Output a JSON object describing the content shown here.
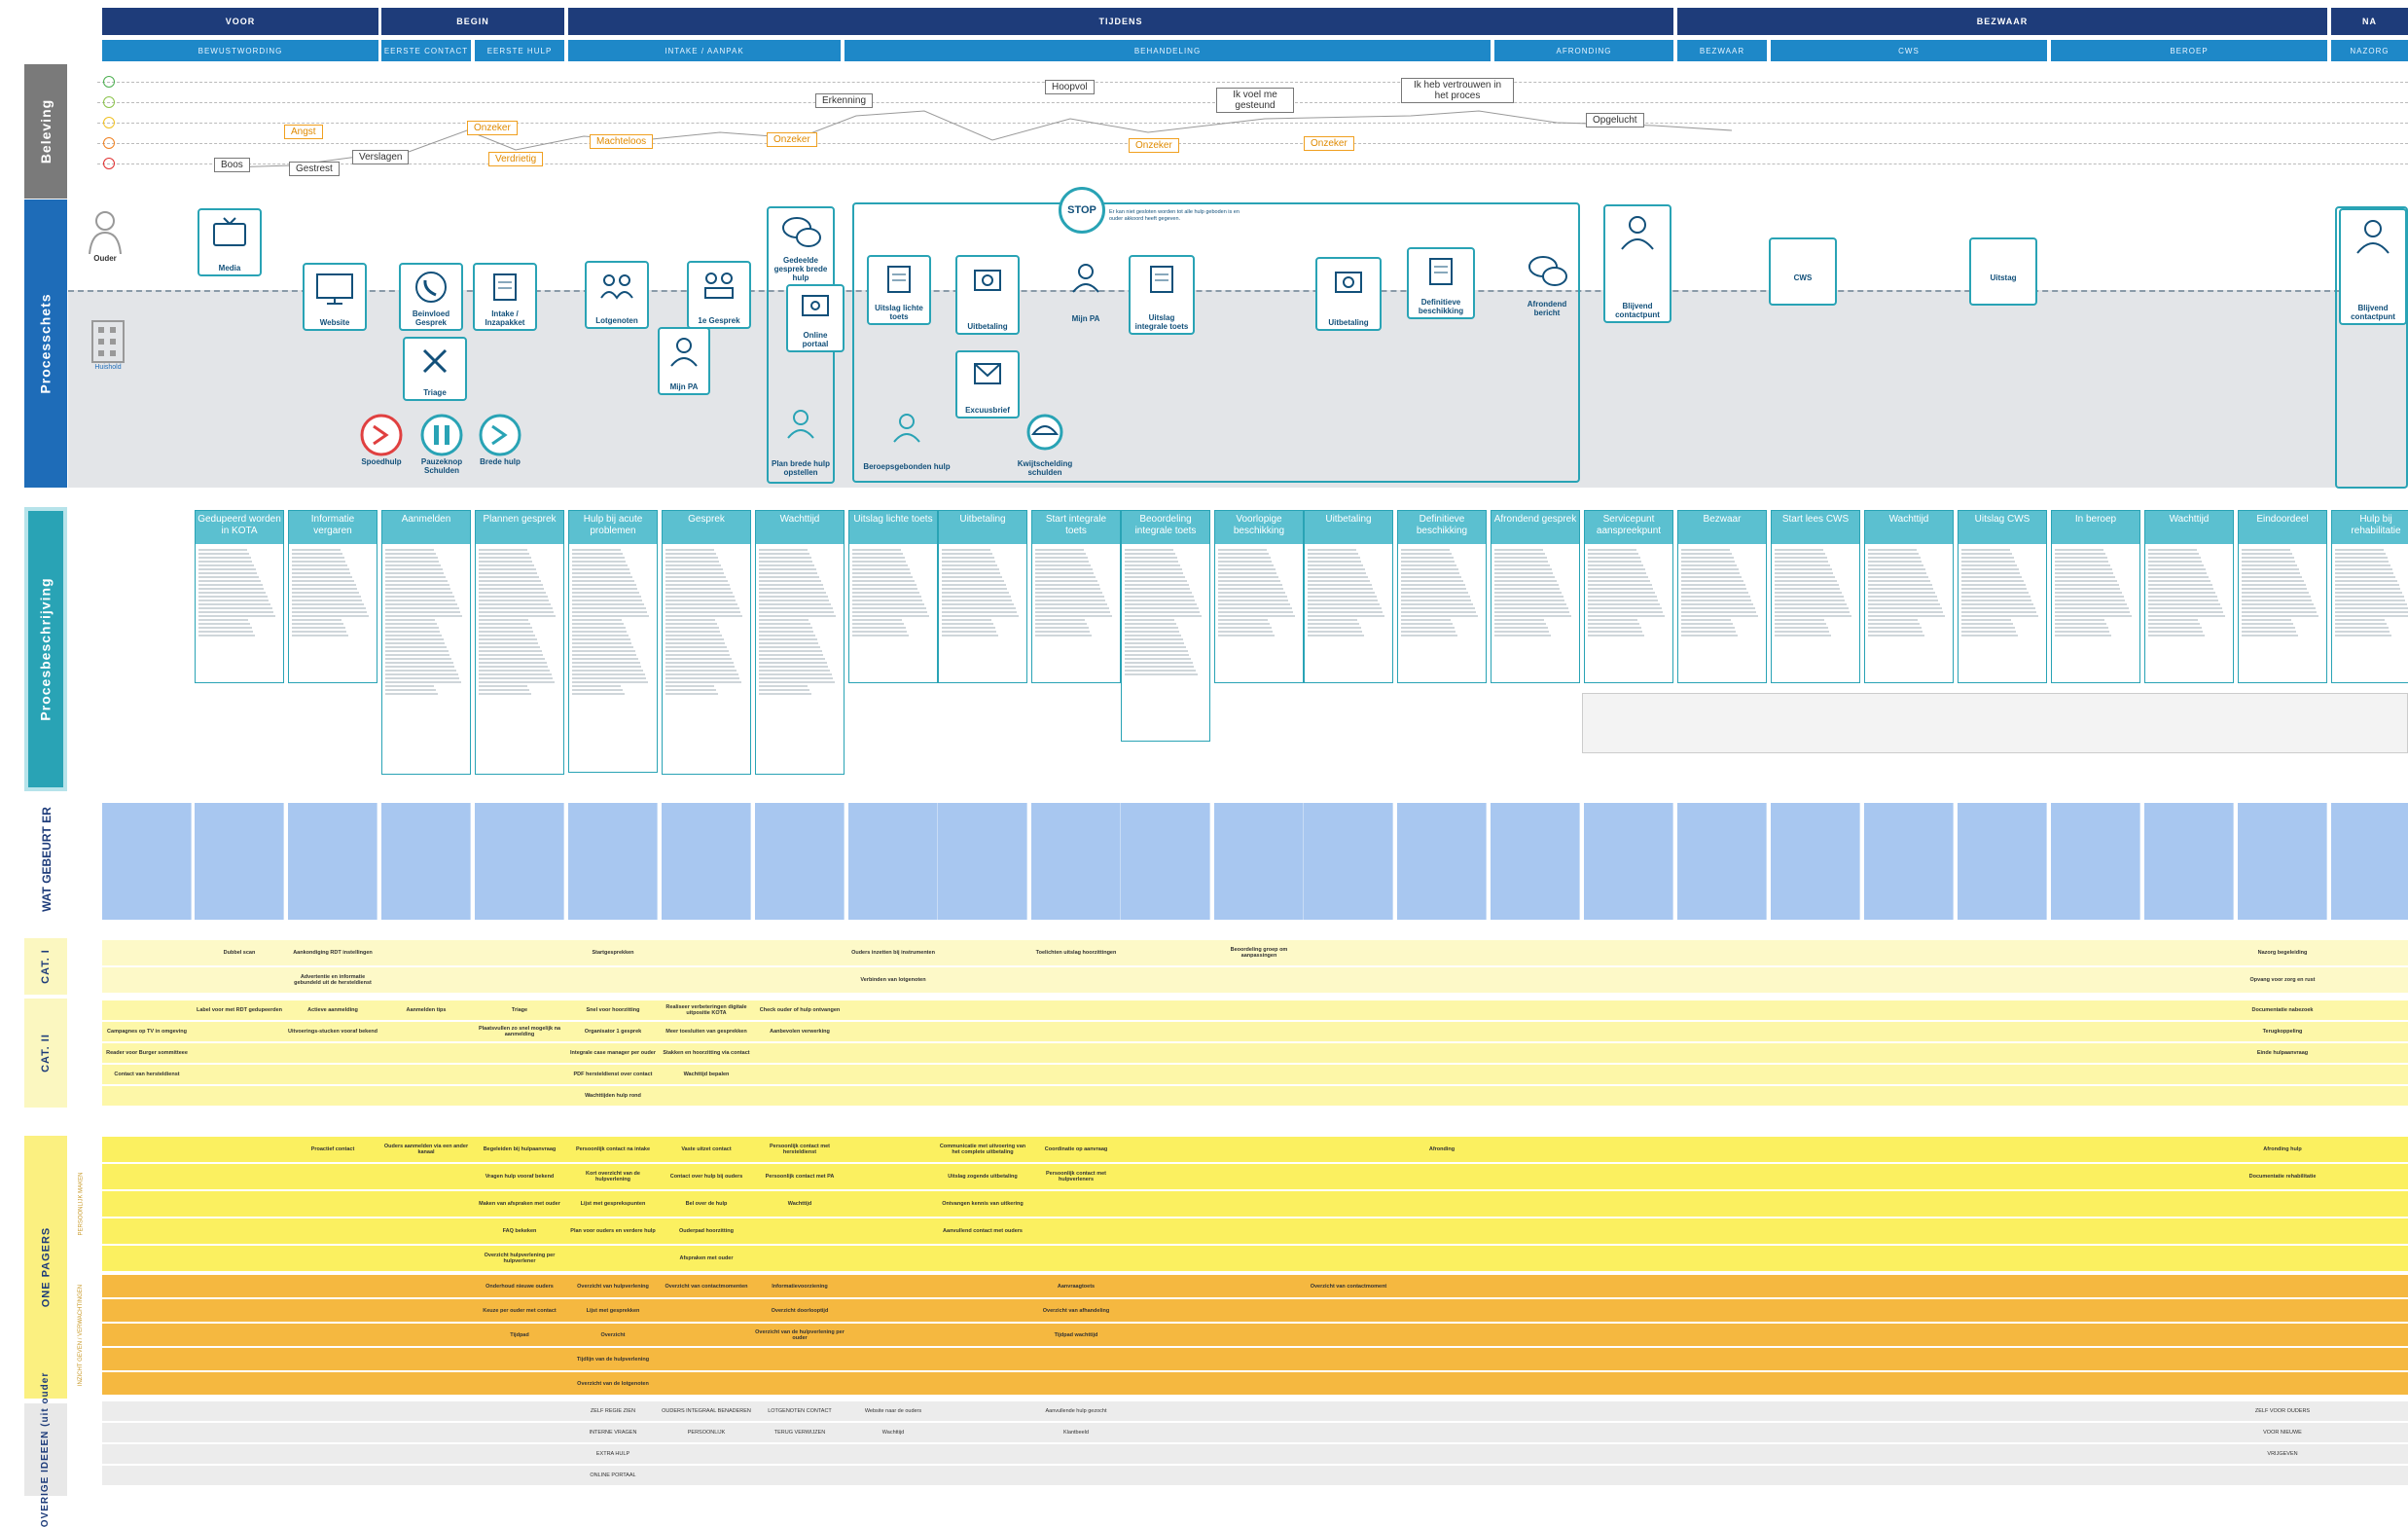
{
  "phases": [
    {
      "label": "VOOR"
    },
    {
      "label": "BEGIN"
    },
    {
      "label": "TIJDENS"
    },
    {
      "label": "BEZWAAR"
    },
    {
      "label": "NA"
    }
  ],
  "subphases": [
    {
      "label": "BEWUSTWORDING"
    },
    {
      "label": "EERSTE CONTACT"
    },
    {
      "label": "EERSTE HULP"
    },
    {
      "label": "INTAKE / AANPAK"
    },
    {
      "label": "BEHANDELING"
    },
    {
      "label": "AFRONDING"
    },
    {
      "label": "BEZWAAR"
    },
    {
      "label": "CWS"
    },
    {
      "label": "BEROEP"
    },
    {
      "label": "NAZORG"
    }
  ],
  "side_labels": {
    "beleving": "Beleving",
    "processchets": "Processchets",
    "procesbeschrijving": "Procesbeschrijving",
    "wat_gebeurt_er": "WAT GEBEURT ER",
    "cat1": "CAT. I",
    "cat2": "CAT. II",
    "one_pagers": "ONE PAGERS",
    "overige": "OVERIGE IDEEEN (uit ouder",
    "sub_persoonlijk": "PERSOONLIJK MAKEN",
    "sub_inzicht": "INZICHT GEVEN / VERWACHTINGEN"
  },
  "emotion_colors": [
    "#4caf50",
    "#8bc34a",
    "#f0c020",
    "#f08020",
    "#e03030"
  ],
  "emotions": [
    {
      "label": "Boos",
      "style": "grey"
    },
    {
      "label": "Gestrest",
      "style": "grey"
    },
    {
      "label": "Verslagen",
      "style": "grey"
    },
    {
      "label": "Angst",
      "style": "orange"
    },
    {
      "label": "Onzeker",
      "style": "orange"
    },
    {
      "label": "Verdrietig",
      "style": "orange"
    },
    {
      "label": "Machteloos",
      "style": "orange"
    },
    {
      "label": "Onzeker",
      "style": "orange"
    },
    {
      "label": "Erkenning",
      "style": "grey"
    },
    {
      "label": "Hoopvol",
      "style": "grey"
    },
    {
      "label": "Ik voel me gesteund",
      "style": "grey"
    },
    {
      "label": "Onzeker",
      "style": "orange"
    },
    {
      "label": "Onzeker",
      "style": "orange"
    },
    {
      "label": "Ik heb vertrouwen in het proces",
      "style": "grey"
    },
    {
      "label": "Opgelucht",
      "style": "grey"
    }
  ],
  "process_icons": [
    {
      "label": "Ouder",
      "icon": "person-icon"
    },
    {
      "label": "Media",
      "icon": "tv-icon"
    },
    {
      "label": "Huishold",
      "icon": "building-icon"
    },
    {
      "label": "Website",
      "icon": "monitor-icon"
    },
    {
      "label": "Beinvloed Gesprek",
      "icon": "phone-icon"
    },
    {
      "label": "Intake / Inzapakket",
      "icon": "document-icon"
    },
    {
      "label": "Triage",
      "icon": "triage-icon"
    },
    {
      "label": "Lotgenoten",
      "icon": "group-icon"
    },
    {
      "label": "1e Gesprek",
      "icon": "meeting-icon"
    },
    {
      "label": "Mijn PA",
      "icon": "person-icon"
    },
    {
      "label": "Gedeelde gesprek brede hulp",
      "icon": "chat-icon"
    },
    {
      "label": "Online portaal",
      "icon": "portal-icon"
    },
    {
      "label": "Plan brede hulp opstellen",
      "icon": "person-icon"
    },
    {
      "label": "Uitslag lichte toets",
      "icon": "document-icon"
    },
    {
      "label": "Uitbetaling",
      "icon": "money-icon"
    },
    {
      "label": "Mijn PA",
      "icon": "person-icon"
    },
    {
      "label": "Uitslag integrale toets",
      "icon": "document-icon"
    },
    {
      "label": "Excuusbrief",
      "icon": "mail-icon"
    },
    {
      "label": "Uitbetaling",
      "icon": "money-icon"
    },
    {
      "label": "Definitieve beschikking",
      "icon": "document-icon"
    },
    {
      "label": "Afrondend bericht",
      "icon": "chat-icon"
    },
    {
      "label": "Blijvend contactpunt",
      "icon": "person-icon"
    },
    {
      "label": "CWS",
      "icon": "blank-icon"
    },
    {
      "label": "Uitstag",
      "icon": "blank-icon"
    },
    {
      "label": "Blijvend contactpunt",
      "icon": "person-icon"
    },
    {
      "label": "Beroepsgebonden hulp",
      "icon": "person-icon"
    },
    {
      "label": "Kwijtschelding schulden",
      "icon": "umbrella-icon"
    },
    {
      "label": "Spoedhulp",
      "icon": "arrow-icon"
    },
    {
      "label": "Pauzeknop Schulden",
      "icon": "pause-icon"
    },
    {
      "label": "Brede hulp",
      "icon": "arrow-icon"
    }
  ],
  "stop_text": "Er kan niet gesloten worden tot alle hulp geboden is en ouder akkoord heeft gegeven.",
  "desc_columns": [
    {
      "title": "Gedupeerd worden in KOTA"
    },
    {
      "title": "Informatie vergaren"
    },
    {
      "title": "Aanmelden"
    },
    {
      "title": "Plannen gesprek"
    },
    {
      "title": "Hulp bij acute problemen"
    },
    {
      "title": "Gesprek"
    },
    {
      "title": "Wachttijd"
    },
    {
      "title": "Uitslag lichte toets"
    },
    {
      "title": "Uitbetaling"
    },
    {
      "title": "Start integrale toets"
    },
    {
      "title": "Beoordeling integrale toets"
    },
    {
      "title": "Voorlopige beschikking"
    },
    {
      "title": "Uitbetaling"
    },
    {
      "title": "Definitieve beschikking"
    },
    {
      "title": "Afrondend gesprek"
    },
    {
      "title": "Servicepunt aanspreekpunt"
    },
    {
      "title": "Bezwaar"
    },
    {
      "title": "Start lees CWS"
    },
    {
      "title": "Wachttijd"
    },
    {
      "title": "Uitslag CWS"
    },
    {
      "title": "In beroep"
    },
    {
      "title": "Wachttijd"
    },
    {
      "title": "Eindoordeel"
    },
    {
      "title": "Hulp bij rehabilitatie"
    }
  ],
  "cat1_rows": [
    [
      "",
      "Dubbel scan",
      "Aankondiging RDT instellingen",
      "",
      "",
      "Startgesprekken",
      "",
      "",
      "Ouders inzetten bij instrumenten",
      "",
      "Toelichten uitslag hoorzittingen",
      "",
      "Beoordeling groep om aanpassingen",
      "",
      "",
      "",
      "",
      "",
      "",
      "",
      "",
      "",
      "",
      "Nazorg begeleiding"
    ],
    [
      "",
      "",
      "Advertentie en informatie gebundeld uit de hersteldienst",
      "",
      "",
      "",
      "",
      "",
      "Verbinden van lotgenoten",
      "",
      "",
      "",
      "",
      "",
      "",
      "",
      "",
      "",
      "",
      "",
      "",
      "",
      "",
      "Opvang voor zorg en rust"
    ]
  ],
  "cat2_rows": [
    [
      "",
      "Label voor met RDT gedupeerden",
      "Actieve aanmelding",
      "Aanmelden tips",
      "Triage",
      "Snel voor hoorzitting",
      "Realiseer verbeteringen digitale uitpositie KOTA",
      "Check ouder of hulp ontvangen",
      "",
      "",
      "",
      "",
      "",
      "",
      "",
      "",
      "",
      "",
      "",
      "",
      "",
      "",
      "",
      "Documentatie nabezoek"
    ],
    [
      "Campagnes op TV in omgeving",
      "",
      "Uitvoerings-stucken vooraf bekend",
      "",
      "Plaatsvullen zo snel mogelijk na aanmelding",
      "Organisator 1 gesprek",
      "Meer toesluiten van gesprekken",
      "Aanbevolen verwerking",
      "",
      "",
      "",
      "",
      "",
      "",
      "",
      "",
      "",
      "",
      "",
      "",
      "",
      "",
      "",
      "Terugkoppeling"
    ],
    [
      "Reader voor Burger sommitteee",
      "",
      "",
      "",
      "",
      "Integrale case manager per ouder",
      "Stakken en hoorzitting via contact",
      "",
      "",
      "",
      "",
      "",
      "",
      "",
      "",
      "",
      "",
      "",
      "",
      "",
      "",
      "",
      "",
      "Einde hulpaanvraag"
    ],
    [
      "Contact van hersteldienst",
      "",
      "",
      "",
      "",
      "PDF hersteldienst over contact",
      "Wachttijd bepalen",
      "",
      "",
      "",
      "",
      "",
      "",
      "",
      "",
      "",
      "",
      "",
      "",
      "",
      "",
      "",
      "",
      ""
    ],
    [
      "",
      "",
      "",
      "",
      "",
      "Wachttijden hulp rond",
      "",
      "",
      "",
      "",
      "",
      "",
      "",
      "",
      "",
      "",
      "",
      "",
      "",
      "",
      "",
      "",
      "",
      ""
    ]
  ],
  "one_pager_rows": [
    [
      "",
      "",
      "Proactief contact",
      "Ouders aanmelden via een ander kanaal",
      "Begeleiden bij hulpaanvraag",
      "Persoonlijk contact na intake",
      "Vaste uitzet contact",
      "Persoonlijk contact met hersteldienst",
      "",
      "Communicatie met uitvoering van het complete uitbetaling",
      "Coordinatie op aanvraag",
      "",
      "",
      "",
      "Afronding",
      "",
      "",
      "",
      "",
      "",
      "",
      "",
      "",
      "Afronding hulp"
    ],
    [
      "",
      "",
      "",
      "",
      "Vragen hulp vooraf bekend",
      "Kort overzicht van de hulpverlening",
      "Contact over hulp bij ouders",
      "Persoonlijk contact met PA",
      "",
      "Uitslag zogende uitbetaling",
      "Persoonlijk contact met hulpverleners",
      "",
      "",
      "",
      "",
      "",
      "",
      "",
      "",
      "",
      "",
      "",
      "",
      "Documentatie rehabilitatie"
    ],
    [
      "",
      "",
      "",
      "",
      "Maken van afspraken met ouder",
      "Lijst met gesprekspunten",
      "Bel over de hulp",
      "Wachttijd",
      "",
      "Ontvangen kennis van uitkering",
      "",
      "",
      "",
      "",
      "",
      "",
      "",
      "",
      "",
      "",
      "",
      "",
      "",
      ""
    ],
    [
      "",
      "",
      "",
      "",
      "FAQ bekeken",
      "Plan voor ouders en verdere hulp",
      "Ouderpad hoorzitting",
      "",
      "",
      "Aanvullend contact met ouders",
      "",
      "",
      "",
      "",
      "",
      "",
      "",
      "",
      "",
      "",
      "",
      "",
      "",
      ""
    ],
    [
      "",
      "",
      "",
      "",
      "Overzicht hulpverlening per hulpverlener",
      "",
      "Afspraken met ouder",
      "",
      "",
      "",
      "",
      "",
      "",
      "",
      "",
      "",
      "",
      "",
      "",
      "",
      "",
      "",
      "",
      ""
    ],
    [
      "",
      "",
      "",
      "",
      "Onderhoud nieuwe ouders",
      "Overzicht van hulpverlening",
      "Overzicht van contactmomenten",
      "Informatievoorziening",
      "",
      "",
      "Aanvraagtoets",
      "",
      "",
      "Overzicht van contactmoment",
      "",
      "",
      "",
      "",
      "",
      "",
      "",
      "",
      "",
      ""
    ],
    [
      "",
      "",
      "",
      "",
      "Keuze per ouder met contact",
      "Lijst met gesprekken",
      "",
      "Overzicht doorlooptijd",
      "",
      "",
      "Overzicht van afhandeling",
      "",
      "",
      "",
      "",
      "",
      "",
      "",
      "",
      "",
      "",
      "",
      "",
      ""
    ],
    [
      "",
      "",
      "",
      "",
      "Tijdpad",
      "Overzicht",
      "",
      "Overzicht van de hulpverlening per ouder",
      "",
      "",
      "Tijdpad wachttijd",
      "",
      "",
      "",
      "",
      "",
      "",
      "",
      "",
      "",
      "",
      "",
      "",
      ""
    ],
    [
      "",
      "",
      "",
      "",
      "",
      "Tijdlijn van de hulpverlening",
      "",
      "",
      "",
      "",
      "",
      "",
      "",
      "",
      "",
      "",
      "",
      "",
      "",
      "",
      "",
      "",
      "",
      ""
    ],
    [
      "",
      "",
      "",
      "",
      "",
      "Overzicht van de lotgenoten",
      "",
      "",
      "",
      "",
      "",
      "",
      "",
      "",
      "",
      "",
      "",
      "",
      "",
      "",
      "",
      "",
      "",
      ""
    ]
  ],
  "overige_rows": [
    [
      "",
      "",
      "",
      "",
      "",
      "ZELF REGIE ZIEN",
      "OUDERS INTEGRAAL BENADEREN",
      "LOTGENOTEN CONTACT",
      "Website naar de ouders",
      "",
      "Aanvullende hulp gezocht",
      "",
      "",
      "",
      "",
      "",
      "",
      "",
      "",
      "",
      "",
      "",
      "",
      "ZELF VOOR OUDERS"
    ],
    [
      "",
      "",
      "",
      "",
      "",
      "INTERNE VRAGEN",
      "PERSOONLIJK",
      "TERUG VERWIJZEN",
      "Wachttijd",
      "",
      "Klantbeeld",
      "",
      "",
      "",
      "",
      "",
      "",
      "",
      "",
      "",
      "",
      "",
      "",
      "VOOR NIEUWE"
    ],
    [
      "",
      "",
      "",
      "",
      "",
      "EXTRA HULP",
      "",
      "",
      "",
      "",
      "",
      "",
      "",
      "",
      "",
      "",
      "",
      "",
      "",
      "",
      "",
      "",
      "",
      "VRIJGEVEN"
    ],
    [
      "",
      "",
      "",
      "",
      "",
      "ONLINE PORTAAL",
      "",
      "",
      "",
      "",
      "",
      "",
      "",
      "",
      "",
      "",
      "",
      "",
      "",
      "",
      "",
      "",
      "",
      ""
    ]
  ]
}
